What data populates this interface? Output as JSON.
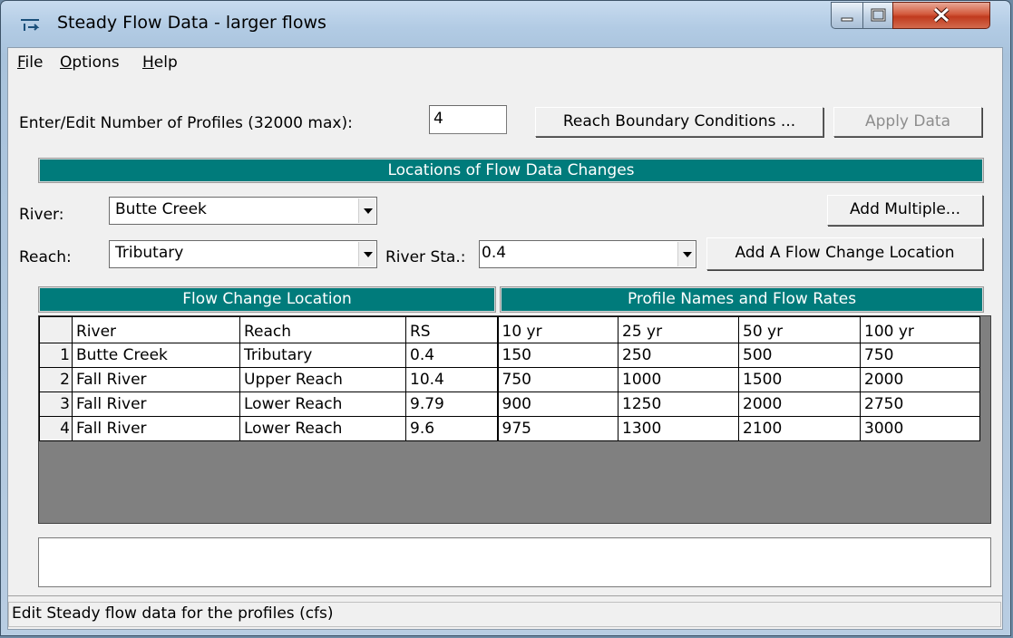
{
  "window": {
    "title": "Steady Flow Data - larger flows"
  },
  "menu": [
    {
      "label": "File",
      "accel": "F",
      "rest": "ile"
    },
    {
      "label": "Options",
      "accel": "O",
      "rest": "ptions"
    },
    {
      "label": "Help",
      "accel": "H",
      "rest": "elp"
    }
  ],
  "profiles": {
    "label": "Enter/Edit Number of Profiles (32000 max):",
    "value": "4"
  },
  "buttons": {
    "reach_boundary": "Reach Boundary Conditions ...",
    "apply_data": "Apply Data",
    "add_multiple": "Add Multiple...",
    "add_flow_change": "Add A Flow Change Location"
  },
  "locations_header": "Locations of Flow Data Changes",
  "selectors": {
    "river_label": "River:",
    "river_value": "Butte Creek",
    "reach_label": "Reach:",
    "reach_value": "Tributary",
    "station_label": "River Sta.:",
    "station_value": "0.4"
  },
  "grid": {
    "group_left": "Flow Change Location",
    "group_right": "Profile Names and Flow Rates",
    "columns": [
      "River",
      "Reach",
      "RS",
      "10 yr",
      "25 yr",
      "50 yr",
      "100 yr"
    ],
    "rows": [
      {
        "n": "1",
        "cells": [
          "Butte Creek",
          "Tributary",
          "0.4",
          "150",
          "250",
          "500",
          "750"
        ]
      },
      {
        "n": "2",
        "cells": [
          "Fall River",
          "Upper Reach",
          "10.4",
          "750",
          "1000",
          "1500",
          "2000"
        ]
      },
      {
        "n": "3",
        "cells": [
          "Fall River",
          "Lower Reach",
          "9.79",
          "900",
          "1250",
          "2000",
          "2750"
        ]
      },
      {
        "n": "4",
        "cells": [
          "Fall River",
          "Lower Reach",
          "9.6",
          "975",
          "1300",
          "2100",
          "3000"
        ]
      }
    ]
  },
  "status": "Edit Steady flow data for the profiles (cfs)",
  "colors": {
    "band": "#007b7b",
    "grid_empty": "#808080",
    "close_button": "#c03a1e"
  },
  "icons": [
    "app-icon",
    "minimize-icon",
    "maximize-icon",
    "close-icon",
    "dropdown-arrow-icon"
  ]
}
